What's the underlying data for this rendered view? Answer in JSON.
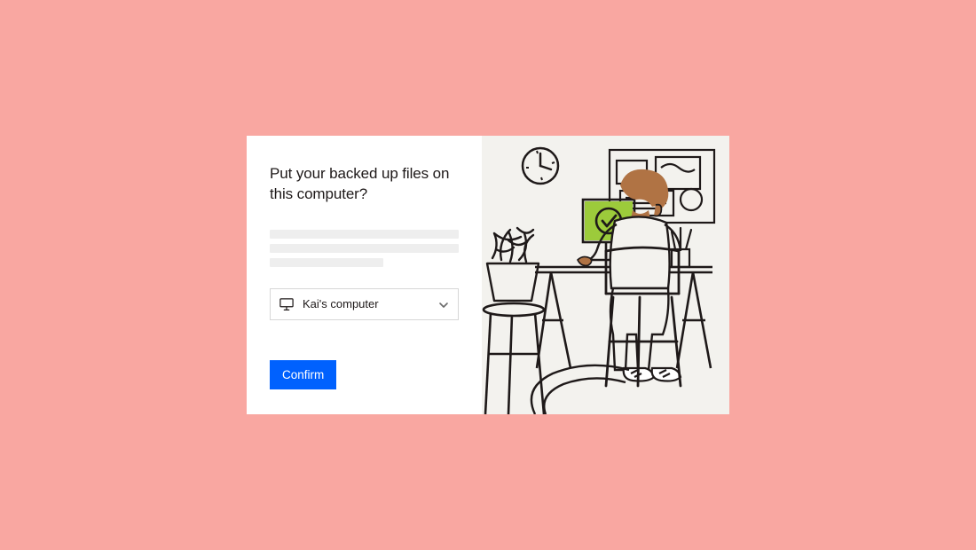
{
  "colors": {
    "page_bg": "#f9a7a1",
    "modal_bg": "#ffffff",
    "illustration_bg": "#f3f2ee",
    "primary": "#0061fe",
    "text": "#1e1919",
    "placeholder": "#eeeeee",
    "border": "#d7d7d7",
    "accent_green": "#a7d129",
    "accent_brown": "#b07344"
  },
  "dialog": {
    "title": "Put your backed up files on this computer?",
    "select": {
      "icon": "monitor-icon",
      "value": "Kai's computer",
      "chevron": "chevron-down-icon"
    },
    "confirm_label": "Confirm"
  },
  "illustration": {
    "description": "Line-drawn person at a desk with plant, clock, pinboard; monitor shows green checkmark",
    "icons": [
      "clock-icon",
      "checkmark-icon"
    ]
  }
}
